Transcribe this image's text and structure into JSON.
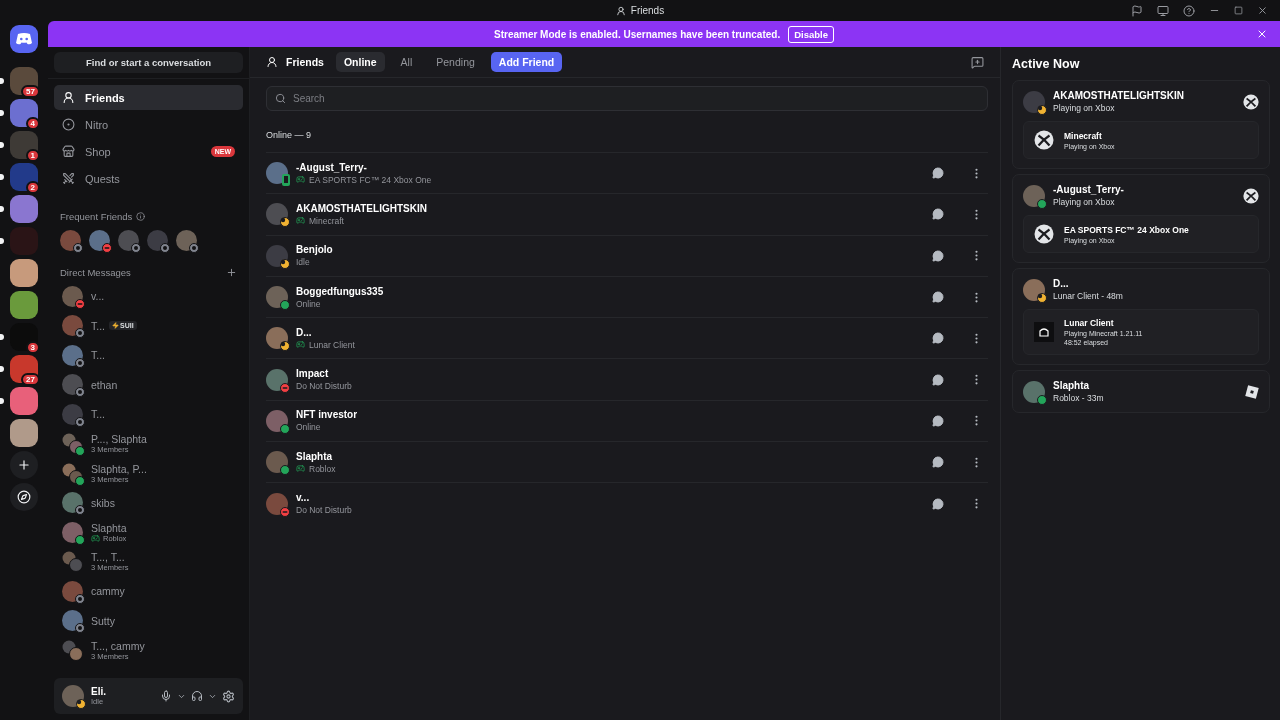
{
  "window": {
    "title": "Friends"
  },
  "servers": [
    {
      "badge": "57",
      "unread": true
    },
    {
      "badge": "4",
      "unread": true
    },
    {
      "badge": "1",
      "unread": true
    },
    {
      "badge": "2",
      "unread": true
    },
    {
      "unread": true
    },
    {
      "unread": true
    },
    {
      "unread": false
    },
    {
      "unread": false
    },
    {
      "badge": "3",
      "unread": true
    },
    {
      "badge": "27",
      "unread": true
    },
    {
      "unread": true
    },
    {
      "unread": false
    }
  ],
  "banner": {
    "text": "Streamer Mode is enabled. Usernames have been truncated.",
    "action": "Disable"
  },
  "sidebar": {
    "search": "Find or start a conversation",
    "nav": [
      {
        "label": "Friends",
        "selected": true
      },
      {
        "label": "Nitro",
        "selected": false
      },
      {
        "label": "Shop",
        "selected": false,
        "badge": "NEW"
      },
      {
        "label": "Quests",
        "selected": false
      }
    ],
    "frequent_title": "Frequent Friends",
    "frequent": [
      {
        "color": "#80848e"
      },
      {
        "color": "#f23f43"
      },
      {
        "color": "#80848e"
      },
      {
        "color": "#80848e"
      },
      {
        "color": "#80848e"
      }
    ],
    "dm_title": "Direct Messages",
    "dms": [
      {
        "name": "v...",
        "kind": "user",
        "color": "#f23f43"
      },
      {
        "name": "T...",
        "kind": "user",
        "color": "#80848e",
        "tag": "SUII"
      },
      {
        "name": "T...",
        "kind": "user",
        "color": "#80848e"
      },
      {
        "name": "ethan",
        "kind": "user",
        "color": "#80848e"
      },
      {
        "name": "T...",
        "kind": "user",
        "color": "#80848e"
      },
      {
        "name": "P..., Slaphta",
        "kind": "group",
        "subtitle": "3 Members",
        "color": "#23a55a"
      },
      {
        "name": "Slaphta, P...",
        "kind": "group",
        "subtitle": "3 Members",
        "color": "#23a55a"
      },
      {
        "name": "skibs",
        "kind": "user",
        "color": "#80848e"
      },
      {
        "name": "Slaphta",
        "kind": "user",
        "subtitle": "Roblox",
        "playing": true,
        "color": "#23a55a"
      },
      {
        "name": "T..., T...",
        "kind": "group",
        "subtitle": "3 Members"
      },
      {
        "name": "cammy",
        "kind": "user",
        "color": "#80848e"
      },
      {
        "name": "Sutty",
        "kind": "user",
        "color": "#80848e"
      },
      {
        "name": "T..., cammy",
        "kind": "group",
        "subtitle": "3 Members"
      }
    ],
    "user": {
      "name": "Eli.",
      "status_text": "Idle",
      "color": "#f0b232"
    }
  },
  "header": {
    "title": "Friends",
    "tabs": [
      {
        "label": "Online",
        "selected": true
      },
      {
        "label": "All",
        "selected": false
      },
      {
        "label": "Pending",
        "selected": false
      }
    ],
    "add_friend": "Add Friend"
  },
  "search": {
    "placeholder": "Search"
  },
  "section_title": "Online — 9",
  "friends": [
    {
      "name": "-August_Terry-",
      "subtitle": "EA SPORTS FC™ 24 Xbox One",
      "playing": true,
      "mobile": true,
      "color": "#23a55a"
    },
    {
      "name": "AKAMOSTHATELIGHTSKIN",
      "subtitle": "Minecraft",
      "playing": true,
      "mobile": false,
      "color": "#f0b232"
    },
    {
      "name": "Benjolo",
      "subtitle": "Idle",
      "playing": false,
      "mobile": false,
      "color": "#f0b232"
    },
    {
      "name": "Boggedfungus335",
      "subtitle": "Online",
      "playing": false,
      "mobile": false,
      "color": "#23a55a"
    },
    {
      "name": "D...",
      "subtitle": "Lunar Client",
      "playing": true,
      "mobile": false,
      "color": "#f0b232"
    },
    {
      "name": "Impact",
      "subtitle": "Do Not Disturb",
      "playing": false,
      "mobile": false,
      "color": "#f23f43"
    },
    {
      "name": "NFT investor",
      "subtitle": "Online",
      "playing": false,
      "mobile": false,
      "color": "#23a55a"
    },
    {
      "name": "Slaphta",
      "subtitle": "Roblox",
      "playing": true,
      "mobile": false,
      "color": "#23a55a"
    },
    {
      "name": "v...",
      "subtitle": "Do Not Disturb",
      "playing": false,
      "mobile": false,
      "color": "#f23f43"
    }
  ],
  "active_now": {
    "title": "Active Now",
    "items": [
      {
        "kind": "xbox",
        "name": "AKAMOSTHATELIGHTSKIN",
        "subtitle": "Playing on Xbox",
        "color": "#f0b232",
        "activity": {
          "title": "Minecraft",
          "lines": [
            "Playing on Xbox"
          ]
        }
      },
      {
        "kind": "xbox",
        "name": "-August_Terry-",
        "subtitle": "Playing on Xbox",
        "color": "#23a55a",
        "activity": {
          "title": "EA SPORTS FC™ 24 Xbox One",
          "lines": [
            "Playing on Xbox"
          ]
        }
      },
      {
        "kind": "app",
        "name": "D...",
        "subtitle": "Lunar Client - 48m",
        "color": "#f0b232",
        "activity": {
          "title": "Lunar Client",
          "lines": [
            "Playing Minecraft 1.21.11",
            "48:52 elapsed"
          ]
        }
      },
      {
        "kind": "roblox",
        "name": "Slaphta",
        "subtitle": "Roblox - 33m",
        "color": "#23a55a"
      }
    ]
  }
}
